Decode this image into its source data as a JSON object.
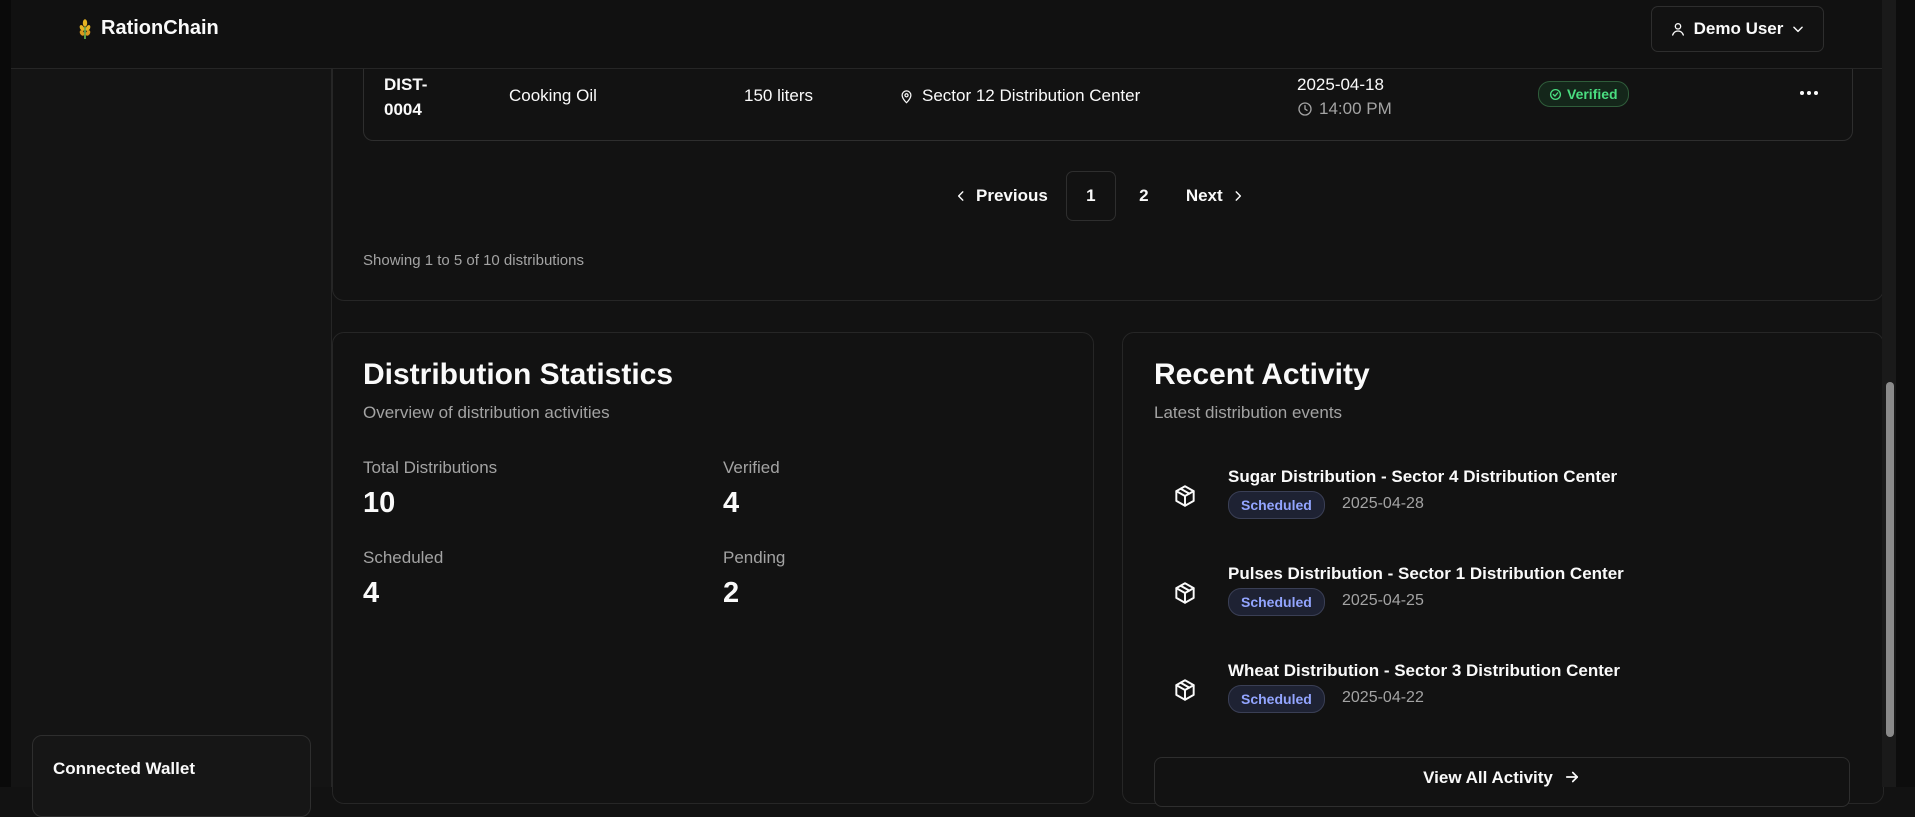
{
  "header": {
    "brand": "RationChain",
    "user_label": "Demo User"
  },
  "sidebar": {
    "wallet_title": "Connected Wallet"
  },
  "distribution_row": {
    "id": "DIST-\n0004",
    "item": "Cooking Oil",
    "quantity": "150 liters",
    "location": "Sector 12 Distribution Center",
    "date": "2025-04-18",
    "time": "14:00 PM",
    "status": "Verified"
  },
  "pagination": {
    "previous_label": "Previous",
    "pages": [
      "1",
      "2"
    ],
    "current_page": "1",
    "next_label": "Next",
    "showing_text": "Showing 1 to 5 of 10 distributions"
  },
  "stats": {
    "title": "Distribution Statistics",
    "subtitle": "Overview of distribution activities",
    "total_label": "Total Distributions",
    "total_value": "10",
    "verified_label": "Verified",
    "verified_value": "4",
    "scheduled_label": "Scheduled",
    "scheduled_value": "4",
    "pending_label": "Pending",
    "pending_value": "2"
  },
  "activity": {
    "title": "Recent Activity",
    "subtitle": "Latest distribution events",
    "items": [
      {
        "title": "Sugar Distribution - Sector 4 Distribution Center",
        "status": "Scheduled",
        "date": "2025-04-28"
      },
      {
        "title": "Pulses Distribution - Sector 1 Distribution Center",
        "status": "Scheduled",
        "date": "2025-04-25"
      },
      {
        "title": "Wheat Distribution - Sector 3 Distribution Center",
        "status": "Scheduled",
        "date": "2025-04-22"
      }
    ],
    "view_all_label": "View All Activity"
  },
  "colors": {
    "background": "#121212",
    "verified": "#4ade80",
    "scheduled": "#93a5ff"
  }
}
